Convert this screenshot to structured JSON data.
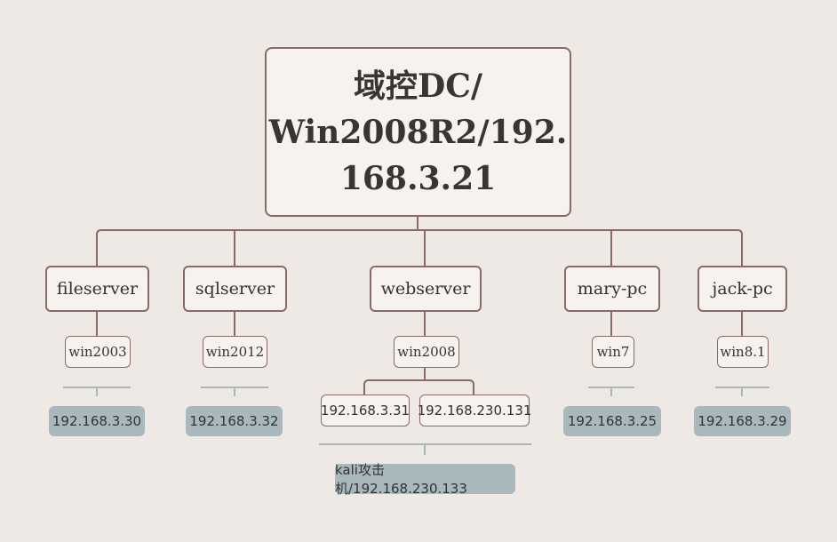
{
  "root": {
    "lines": [
      "域控DC/",
      "Win2008R2/192.",
      "168.3.21"
    ]
  },
  "hosts": [
    {
      "name": "fileserver",
      "os": "win2003",
      "ip": "192.168.3.30"
    },
    {
      "name": "sqlserver",
      "os": "win2012",
      "ip": "192.168.3.32"
    },
    {
      "name": "webserver",
      "os": "win2008",
      "ips": [
        "192.168.3.31",
        "192.168.230.131"
      ],
      "attacker": "kali攻击机/192.168.230.133"
    },
    {
      "name": "mary-pc",
      "os": "win7",
      "ip": "192.168.3.25"
    },
    {
      "name": "jack-pc",
      "os": "win8.1",
      "ip": "192.168.3.29"
    }
  ],
  "colors": {
    "background": "#efe9e6",
    "node_border": "#8a6a66",
    "connector": "#8a6a66",
    "ip_fill": "#a8b8bd",
    "bracket": "#a8b8bd"
  }
}
